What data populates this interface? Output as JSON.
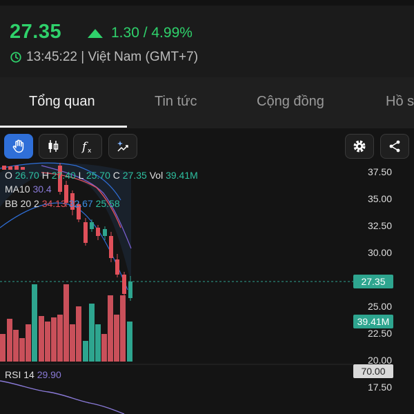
{
  "quote": {
    "price": "27.35",
    "change": "1.30 / 4.99%",
    "time": "13:45:22 | Việt Nam (GMT+7)"
  },
  "tabs": [
    {
      "label": "Tổng quan",
      "active": true
    },
    {
      "label": "Tin tức",
      "active": false
    },
    {
      "label": "Cộng đồng",
      "active": false
    },
    {
      "label": "Hồ s",
      "active": false
    }
  ],
  "toolbar": {
    "left": [
      "hand-icon",
      "candlestick-icon",
      "function-icon",
      "magic-chart-icon"
    ],
    "right": [
      "gear-icon",
      "share-icon"
    ]
  },
  "ohlc": {
    "o_label": "O",
    "o_value": "26.70",
    "h_label": "H",
    "h_value": "27.40",
    "l_label": "L",
    "l_value": "25.70",
    "c_label": "C",
    "c_value": "27.35",
    "vol_label": "Vol",
    "vol_value": "39.41M"
  },
  "indicators": {
    "ma_label": "MA10",
    "ma_value": "30.4",
    "bb_label": "BB 20 2",
    "bb_upper": "34.13",
    "bb_mid": "32.67",
    "bb_lower": "25.58",
    "rsi_label": "RSI 14",
    "rsi_value": "29.90"
  },
  "price_axis": [
    "37.50",
    "35.00",
    "32.50",
    "30.00",
    "27.35",
    "25.00",
    "39.41M",
    "22.50",
    "20.00",
    "70.00",
    "17.50"
  ],
  "badges": {
    "last_price": "27.35",
    "volume": "39.41M",
    "rsi_level": "70.00"
  },
  "colors": {
    "up": "#2fd16b",
    "candle_up": "#2ea58f",
    "candle_down": "#e0505a",
    "active_tool": "#2f6fd8"
  }
}
